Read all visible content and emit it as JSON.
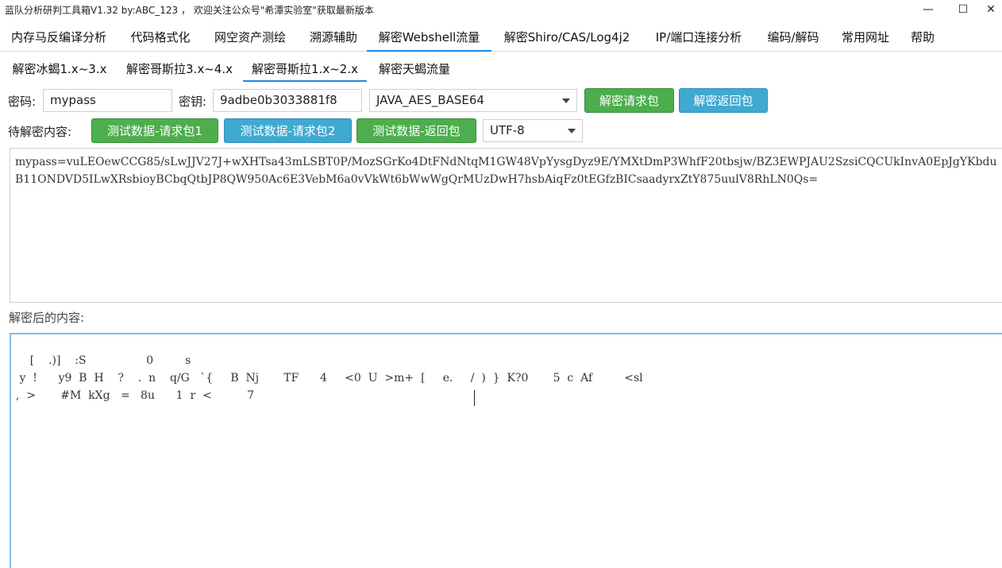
{
  "window": {
    "title": "蓝队分析研判工具箱V1.32 by:ABC_123 ， 欢迎关注公众号\"希潭实验室\"获取最新版本",
    "minimize_glyph": "—",
    "maximize_glyph": "☐",
    "close_glyph": "✕"
  },
  "menu": {
    "items": [
      {
        "label": "内存马反编译分析"
      },
      {
        "label": "代码格式化"
      },
      {
        "label": "网空资产测绘"
      },
      {
        "label": "溯源辅助"
      },
      {
        "label": "解密Webshell流量"
      },
      {
        "label": "解密Shiro/CAS/Log4j2"
      },
      {
        "label": "IP/端口连接分析"
      },
      {
        "label": "编码/解码"
      },
      {
        "label": "常用网址"
      },
      {
        "label": "帮助"
      }
    ],
    "active_index": 4
  },
  "subtabs": {
    "items": [
      {
        "label": "解密冰蝎1.x~3.x"
      },
      {
        "label": "解密哥斯拉3.x~4.x"
      },
      {
        "label": "解密哥斯拉1.x~2.x"
      },
      {
        "label": "解密天蝎流量"
      }
    ],
    "active_index": 2
  },
  "form": {
    "password_label": "密码:",
    "password_value": "mypass",
    "key_label": "密钥:",
    "key_value": "9adbe0b3033881f8",
    "mode_value": "JAVA_AES_BASE64",
    "decrypt_request_label": "解密请求包",
    "decrypt_response_label": "解密返回包",
    "pending_label": "待解密内容:",
    "test_request1_label": "测试数据-请求包1",
    "test_request2_label": "测试数据-请求包2",
    "test_response_label": "测试数据-返回包",
    "charset_value": "UTF-8"
  },
  "input_area": {
    "text": "mypass=vuLEOewCCG85/sLwJJV27J+wXHTsa43mLSBT0P/MozSGrKo4DtFNdNtqM1GW48VpYysgDyz9E/YMXtDmP3WhfF20tbsjw/BZ3EWPJAU2SzsiCQCUkInvA0EpJgYKbduB11ONDVD5ILwXRsbioyBCbqQtbJP8QW950Ac6E3VebM6a0vVkWt6bWwWgQrMUzDwH7hsbAiqFz0tEGfzBICsaadyrxZtY875uulV8RhLN0Qs="
  },
  "output": {
    "label": "解密后的内容:",
    "lines": [
      "    [    .)]    :S                 0         s",
      " y  !      y9  B  H    ?    .  n    q/G   `{     B  Nj       TF      4     <0  U  >m+  [     e.     /  )  }  K?0       5  c  Af         <sl",
      ",  >       #M  kXg   =   8u      1  r  <          7"
    ]
  }
}
